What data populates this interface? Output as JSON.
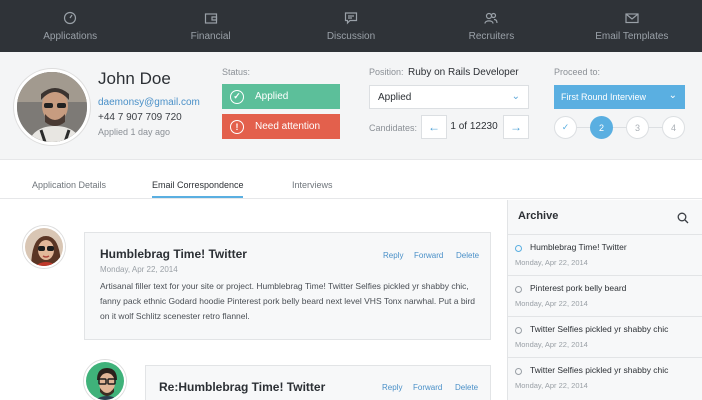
{
  "nav": [
    {
      "label": "Applications",
      "icon": "dashboard-icon"
    },
    {
      "label": "Financial",
      "icon": "wallet-icon"
    },
    {
      "label": "Discussion",
      "icon": "chat-icon"
    },
    {
      "label": "Recruiters",
      "icon": "users-icon"
    },
    {
      "label": "Email Templates",
      "icon": "envelope-icon"
    }
  ],
  "profile": {
    "name": "John Doe",
    "email": "daemonsy@gmail.com",
    "phone": "+44 7 907 709 720",
    "applied": "Applied 1 day ago"
  },
  "status": {
    "label": "Status:",
    "applied": "Applied",
    "attention": "Need attention",
    "applied_color": "#5cbf9a",
    "attention_color": "#e3604c"
  },
  "position": {
    "label": "Position:",
    "value": "Ruby on Rails Developer",
    "stage_selected": "Applied",
    "candidates_label": "Candidates:",
    "pager": "1 of 12230"
  },
  "proceed": {
    "label": "Proceed to:",
    "selected": "First Round Interview",
    "steps": [
      "✓",
      "2",
      "3",
      "4"
    ],
    "accent": "#5aafe1"
  },
  "tabs": [
    "Application Details",
    "Email Correspondence",
    "Interviews"
  ],
  "messages": [
    {
      "title": "Humblebrag Time!   Twitter",
      "date": "Monday, Apr 22, 2014",
      "actions": [
        "Reply",
        "Forward",
        "Delete"
      ],
      "body": "Artisanal filler text for your site or project.    Humblebrag Time!   Twitter Selfies pickled yr shabby chic, fanny pack ethnic Godard hoodie Pinterest pork belly beard next level VHS Tonx narwhal. Put a bird on it wolf Schlitz scenester retro flannel."
    },
    {
      "title": "Re:Humblebrag Time!   Twitter",
      "date": "",
      "actions": [
        "Reply",
        "Forward",
        "Delete"
      ],
      "body": ""
    }
  ],
  "archive": {
    "title": "Archive",
    "items": [
      {
        "text": "Humblebrag Time!   Twitter",
        "date": "Monday, Apr 22, 2014"
      },
      {
        "text": "Pinterest pork belly beard",
        "date": "Monday, Apr 22, 2014"
      },
      {
        "text": "Twitter Selfies pickled yr shabby chic",
        "date": "Monday, Apr 22, 2014"
      },
      {
        "text": "Twitter Selfies pickled yr shabby chic",
        "date": "Monday, Apr 22, 2014"
      }
    ]
  }
}
